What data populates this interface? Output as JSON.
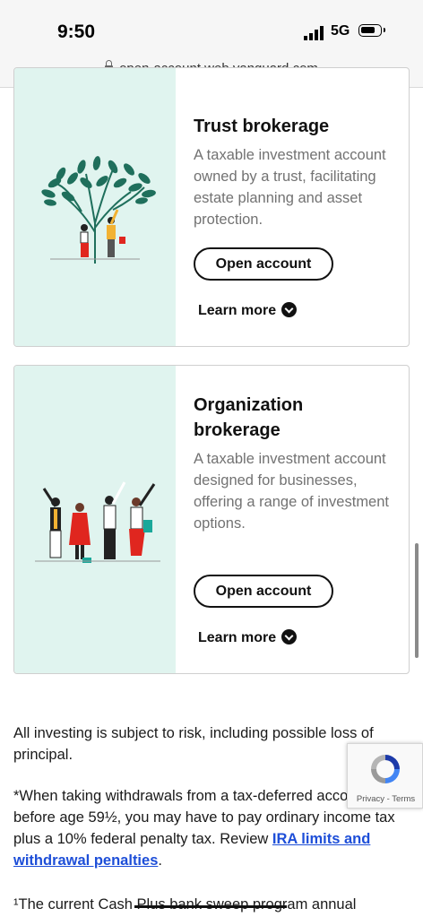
{
  "status_bar": {
    "time": "9:50",
    "network": "5G"
  },
  "browser": {
    "url": "open-account.web.vanguard.com"
  },
  "cards": [
    {
      "title": "Trust brokerage",
      "description": "A taxable investment account owned by a trust, facilitating estate planning and asset protection.",
      "button": "Open account",
      "learn_more": "Learn more"
    },
    {
      "title": "Organization brokerage",
      "description": "A taxable investment account designed for businesses, offering a range of investment options.",
      "button": "Open account",
      "learn_more": "Learn more"
    }
  ],
  "disclosures": {
    "risk": "All investing is subject to risk, including possible loss of principal.",
    "withdrawal_text": "*When taking withdrawals from a tax-deferred account before age 59½, you may have to pay ordinary income tax plus a 10% federal penalty tax. Review",
    "withdrawal_link": "IRA limits and withdrawal penalties",
    "withdrawal_end": ".",
    "footnote": "¹The current Cash Plus bank sweep program annual"
  },
  "recaptcha": {
    "legal": "Privacy - Terms"
  },
  "colors": {
    "illustration_bg": "#e0f4ef",
    "link": "#1d4ed8",
    "tree": "#1f6f5c",
    "accent_red": "#e0261f",
    "accent_yellow": "#f2b233"
  },
  "icons": [
    "lock-icon",
    "signal-icon",
    "battery-icon",
    "chevron-down-icon",
    "recaptcha-icon"
  ]
}
